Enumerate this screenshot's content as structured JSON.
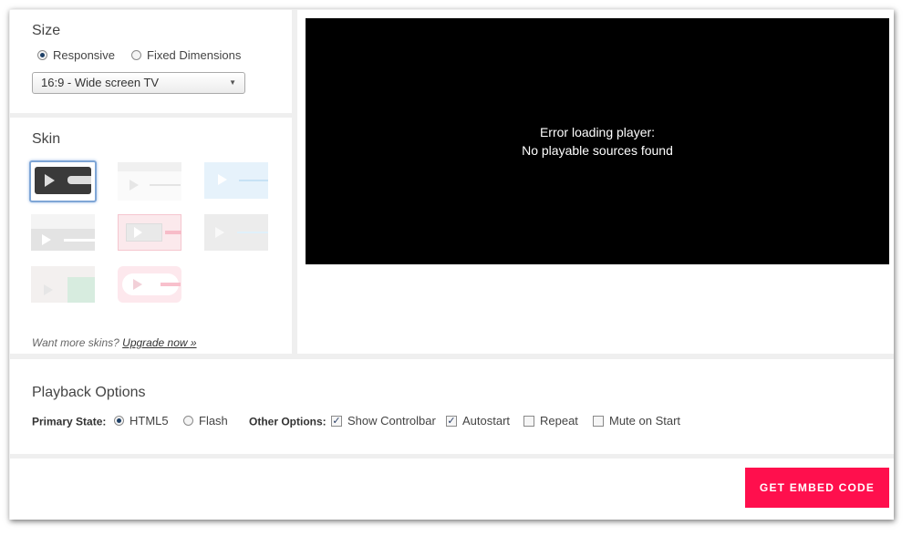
{
  "size": {
    "title": "Size",
    "options": [
      {
        "label": "Responsive",
        "selected": true
      },
      {
        "label": "Fixed Dimensions",
        "selected": false
      }
    ],
    "aspect_select": {
      "value": "16:9 - Wide screen TV"
    }
  },
  "skin": {
    "title": "Skin",
    "upsell_text": "Want more skins?",
    "upsell_link": "Upgrade now »"
  },
  "player": {
    "error_line1": "Error loading player:",
    "error_line2": "No playable sources found"
  },
  "playback": {
    "title": "Playback Options",
    "primary_state_label": "Primary State:",
    "primary_states": [
      {
        "label": "HTML5",
        "selected": true
      },
      {
        "label": "Flash",
        "selected": false
      }
    ],
    "other_options_label": "Other Options:",
    "other_options": [
      {
        "label": "Show Controlbar",
        "checked": true
      },
      {
        "label": "Autostart",
        "checked": true
      },
      {
        "label": "Repeat",
        "checked": false
      },
      {
        "label": "Mute on Start",
        "checked": false
      }
    ]
  },
  "footer": {
    "embed_button": "GET EMBED CODE"
  },
  "colors": {
    "accent": "#ff0f4d",
    "background": "#efefef",
    "player_bg": "#000000"
  }
}
